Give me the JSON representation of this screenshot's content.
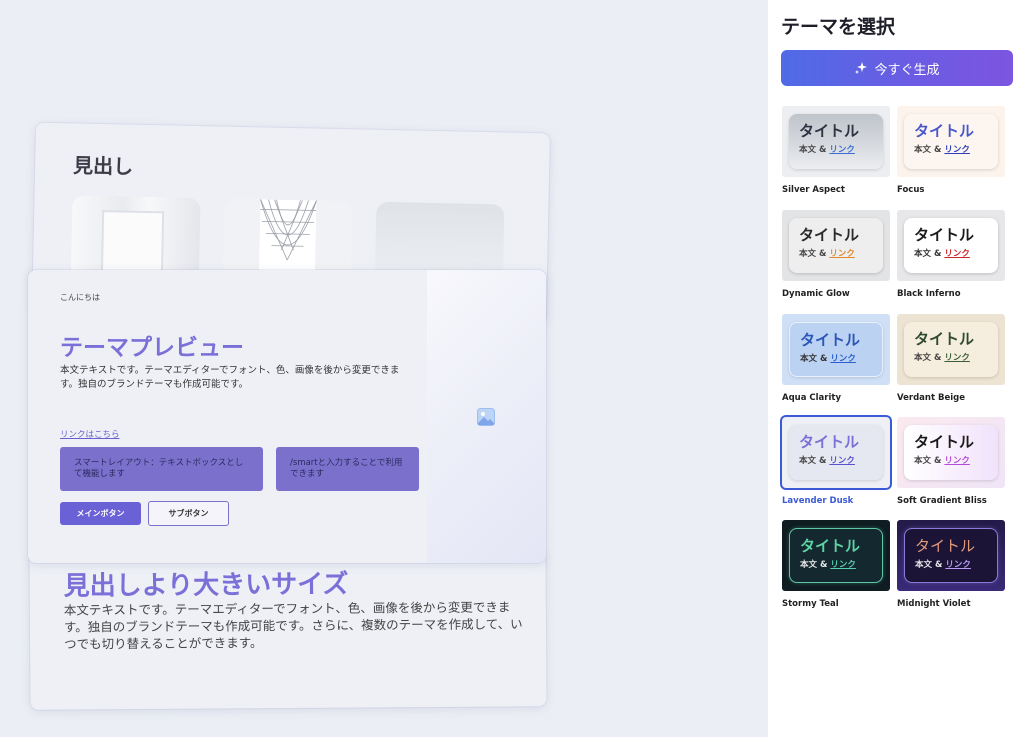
{
  "preview": {
    "top_card": {
      "heading": "見出し"
    },
    "main_card": {
      "greeting": "こんにちは",
      "title": "テーマプレビュー",
      "body": "本文テキストです。テーマエディターでフォント、色、画像を後から変更できます。独自のブランドテーマも作成可能です。",
      "link": "リンクはこちら",
      "box1": "スマートレイアウト：テキストボックスとして機能します",
      "box2": "/smartと入力することで利用できます",
      "primary_button": "メインボタン",
      "secondary_button": "サブボタン"
    },
    "bottom_card": {
      "heading": "見出しより大きいサイズ",
      "body": "本文テキストです。テーマエディターでフォント、色、画像を後から変更できます。独自のブランドテーマも作成可能です。さらに、複数のテーマを作成して、いつでも切り替えることができます。"
    }
  },
  "sidebar": {
    "title": "テーマを選択",
    "generate_button": "今すぐ生成",
    "sample": {
      "title": "タイトル",
      "body": "本文",
      "amp": "&",
      "link": "リンク"
    },
    "themes": [
      {
        "name": "Silver Aspect"
      },
      {
        "name": "Focus"
      },
      {
        "name": "Dynamic Glow"
      },
      {
        "name": "Black Inferno"
      },
      {
        "name": "Aqua Clarity"
      },
      {
        "name": "Verdant Beige"
      },
      {
        "name": "Lavender Dusk",
        "selected": true
      },
      {
        "name": "Soft Gradient Bliss"
      },
      {
        "name": "Stormy Teal"
      },
      {
        "name": "Midnight Violet"
      }
    ]
  },
  "colors": {
    "accent": "#7b6fd8",
    "generate_gradient_start": "#4f6be6",
    "generate_gradient_end": "#7c55e0",
    "selected_outline": "#3a5ad6"
  }
}
